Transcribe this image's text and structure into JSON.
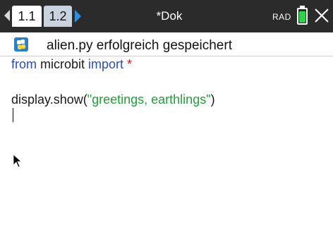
{
  "tabs": [
    {
      "label": "1.1",
      "active": true
    },
    {
      "label": "1.2",
      "active": false
    }
  ],
  "document_title": "*Dok",
  "angle_mode": "RAD",
  "battery_level": 1.0,
  "status_message": "alien.py erfolgreich gespeichert",
  "code": {
    "line1": {
      "kw1": "from",
      "mod": " microbit ",
      "kw2": "import",
      "star": " *"
    },
    "line2": {
      "func": "display.show(",
      "string": "\"greetings, earthlings\"",
      "close": ")"
    }
  },
  "colors": {
    "accent": "#2f8fe0",
    "keyword": "#2a4fb0",
    "string": "#21a038",
    "battery": "#2fd24a"
  },
  "icons": [
    "nav-left-icon",
    "nav-right-icon",
    "battery-icon",
    "close-icon",
    "python-icon",
    "mouse-pointer-icon"
  ]
}
